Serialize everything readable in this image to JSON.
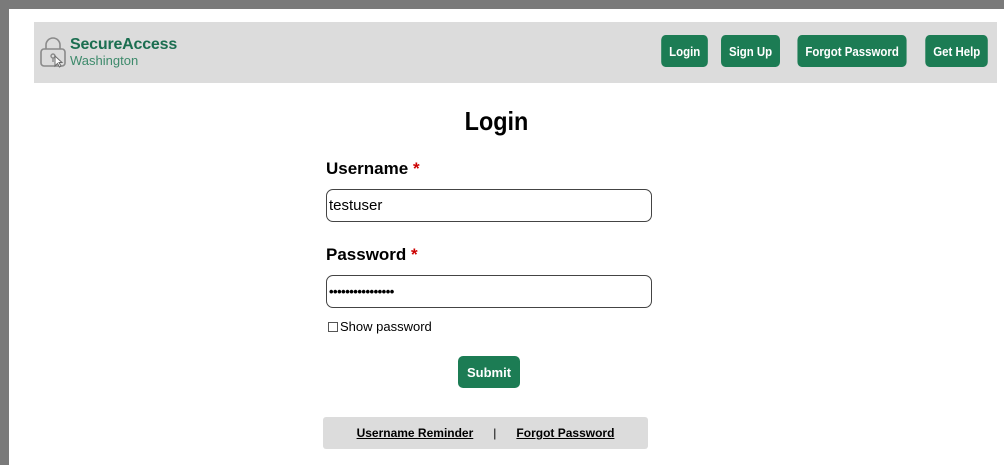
{
  "header": {
    "logo_line1": "SecureAccess",
    "logo_line2": "Washington",
    "nav": [
      {
        "label": "Login"
      },
      {
        "label": "Sign Up"
      },
      {
        "label": "Forgot Password"
      },
      {
        "label": "Get Help"
      }
    ]
  },
  "form": {
    "title": "Login",
    "username_label": "Username",
    "username_value": "testuser",
    "password_label": "Password",
    "password_value": "••••••••••••••••",
    "required_marker": "*",
    "show_password_label": "Show password",
    "show_password_checked": false,
    "submit_label": "Submit"
  },
  "footer": {
    "username_reminder": "Username Reminder",
    "separator": "|",
    "forgot_password": "Forgot Password"
  },
  "colors": {
    "brand_green": "#1c7c54",
    "logo_green": "#1b6e50",
    "required_red": "#cc0000",
    "bar_gray": "#dcdcdc"
  }
}
